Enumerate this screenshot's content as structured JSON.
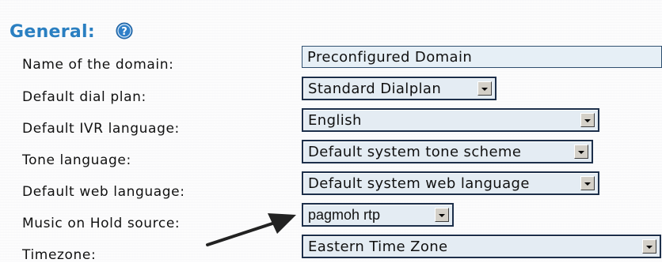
{
  "section": {
    "title": "General:",
    "help_icon": "question-circle-icon",
    "accent": "#2a7fc1"
  },
  "fields": {
    "domain_name": {
      "label": "Name of the domain:",
      "value": "Preconfigured Domain"
    },
    "dial_plan": {
      "label": "Default dial plan:",
      "selected": "Standard Dialplan"
    },
    "ivr_language": {
      "label": "Default IVR language:",
      "selected": "English"
    },
    "tone_language": {
      "label": "Tone language:",
      "selected": "Default system tone scheme"
    },
    "web_language": {
      "label": "Default web language:",
      "selected": "Default system web language"
    },
    "moh_source": {
      "label": "Music on Hold source:",
      "selected": "pagmoh rtp"
    },
    "timezone": {
      "label": "Timezone:",
      "selected": "Eastern Time Zone"
    }
  },
  "annotation": {
    "arrow_icon": "pointer-arrow-icon",
    "arrow_color": "#222222"
  }
}
